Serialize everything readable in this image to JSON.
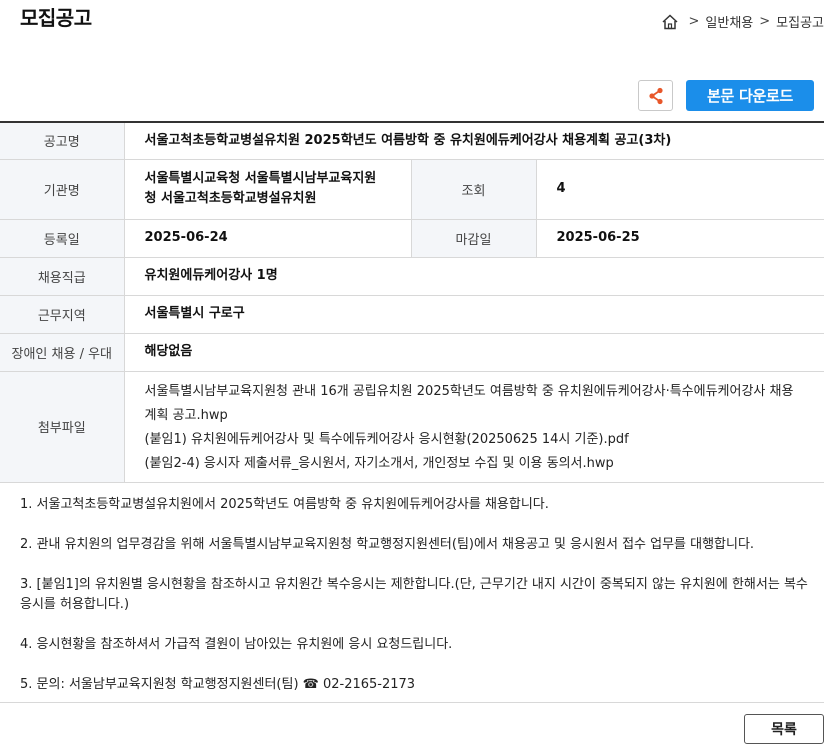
{
  "page": {
    "title": "모집공고"
  },
  "breadcrumb": {
    "home_icon": "home-icon",
    "separator": ">",
    "items": [
      "일반채용",
      "모집공고"
    ]
  },
  "toolbar": {
    "share_icon": "share-icon",
    "download_label": "본문 다운로드"
  },
  "info": {
    "title_label": "공고명",
    "title_value": "서울고척초등학교병설유치원 2025학년도 여름방학 중 유치원에듀케어강사 채용계획 공고(3차)",
    "org_label": "기관명",
    "org_value_line1": "서울특별시교육청 서울특별시남부교육지원",
    "org_value_line2": "청 서울고척초등학교병설유치원",
    "views_label": "조회",
    "views_value": "4",
    "reg_label": "등록일",
    "reg_value": "2025-06-24",
    "deadline_label": "마감일",
    "deadline_value": "2025-06-25",
    "position_label": "채용직급",
    "position_value": "유치원에듀케어강사 1명",
    "region_label": "근무지역",
    "region_value": "서울특별시 구로구",
    "disability_label": "장애인 채용 / 우대",
    "disability_value": "해당없음",
    "files_label": "첨부파일",
    "files": [
      "서울특별시남부교육지원청 관내 16개 공립유치원 2025학년도 여름방학 중 유치원에듀케어강사·특수에듀케어강사 채용계획 공고.hwp",
      "(붙임1) 유치원에듀케어강사 및 특수에듀케어강사 응시현황(20250625 14시 기준).pdf",
      "(붙임2-4) 응시자 제출서류_응시원서, 자기소개서, 개인정보 수집 및 이용 동의서.hwp"
    ]
  },
  "notice": [
    "1. 서울고척초등학교병설유치원에서 2025학년도 여름방학 중 유치원에듀케어강사를 채용합니다.",
    "2. 관내 유치원의 업무경감을 위해 서울특별시남부교육지원청 학교행정지원센터(팀)에서 채용공고 및 응시원서 접수 업무를 대행합니다.",
    "3. [붙임1]의 유치원별 응시현황을 참조하시고 유치원간 복수응시는 제한합니다.(단, 근무기간 내지 시간이 중복되지 않는 유치원에 한해서는 복수응시를 허용합니다.)",
    "4. 응시현황을 참조하셔서 가급적 결원이 남아있는 유치원에 응시 요청드립니다.",
    "5. 문의: 서울남부교육지원청 학교행정지원센터(팀) ☎ 02-2165-2173"
  ],
  "footer": {
    "list_label": "목록"
  },
  "colors": {
    "accent": "#1b8eea",
    "share": "#e8572a",
    "header_bg": "#f4f6f9"
  }
}
